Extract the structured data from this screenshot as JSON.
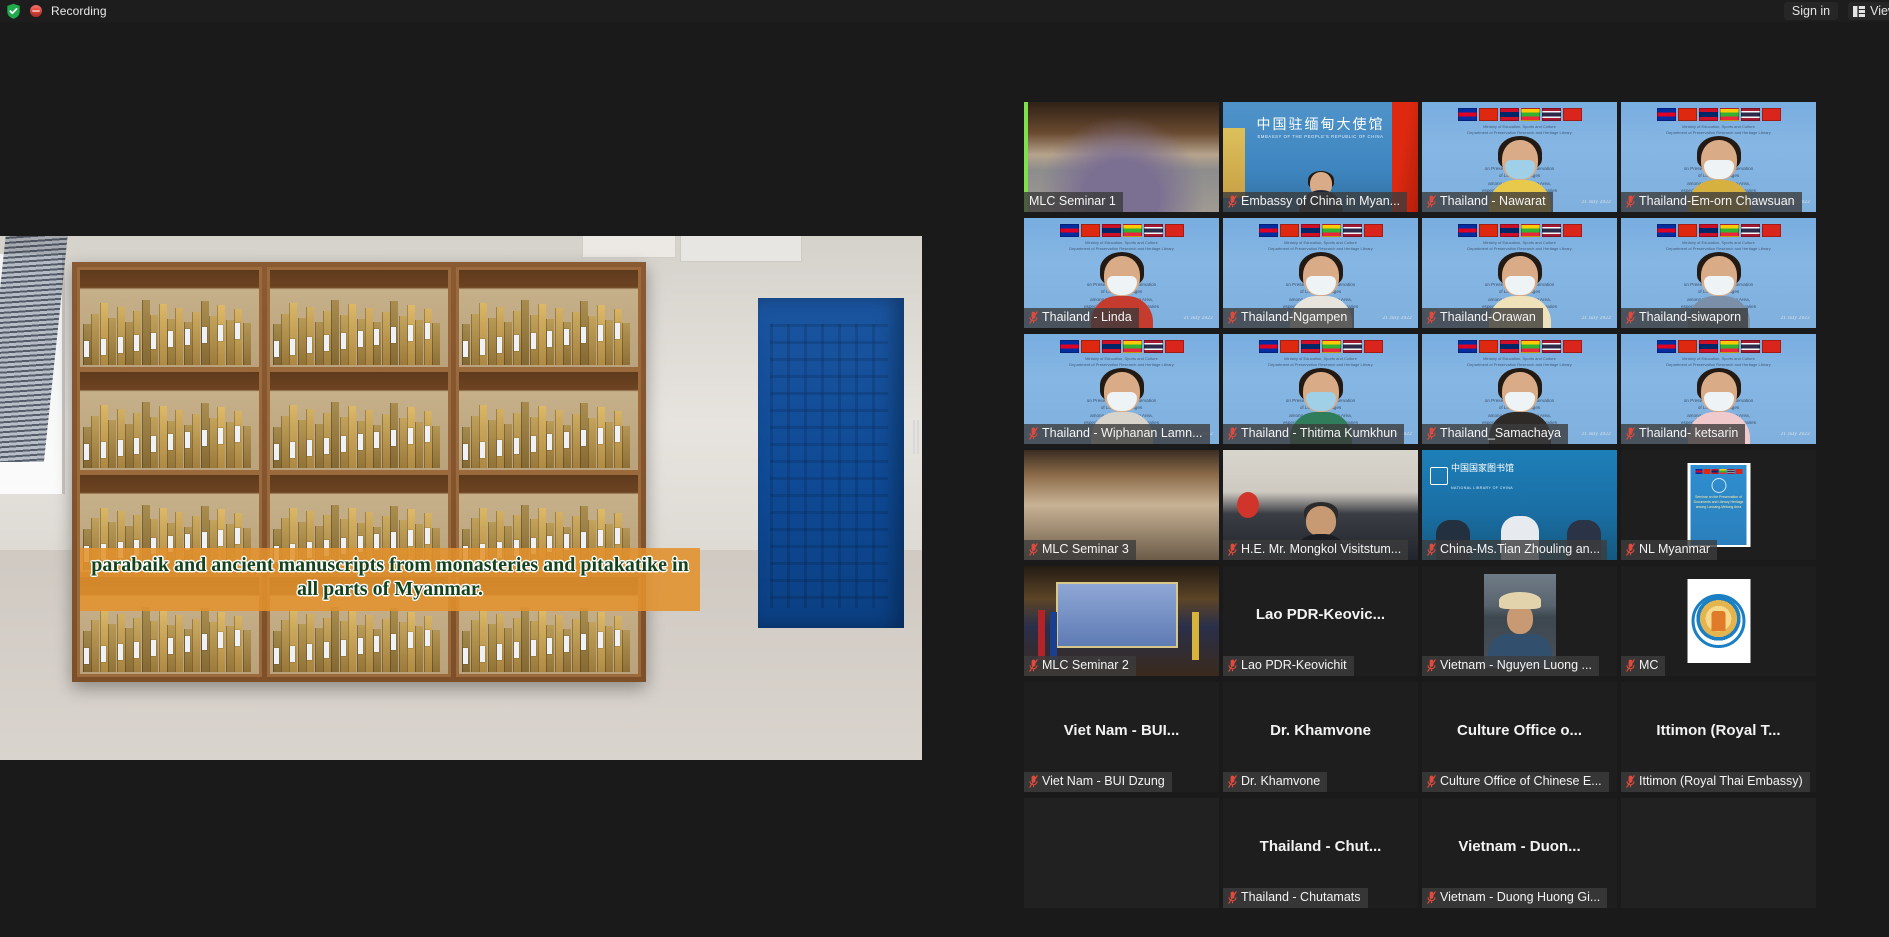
{
  "topbar": {
    "shield_icon": "shield-check-icon",
    "recording_icon": "recording-dot-icon",
    "recording_label": "Recording",
    "sign_in_label": "Sign in",
    "view_label": "View",
    "view_icon": "view-layout-icon"
  },
  "stage": {
    "caption": "parabaik and ancient manuscripts from monasteries and pitakatike in all parts of Myanmar.",
    "scrollbar_icon": "vertical-scrollbar"
  },
  "gallery": {
    "mic_icon": "microphone-muted-icon",
    "timestamp": "21 July 2022",
    "tiles": [
      {
        "name": "MLC Seminar 1",
        "active": true,
        "muted": false,
        "kind": "seminar1",
        "placeholder": false
      },
      {
        "name": "Embassy of China in Myan...",
        "active": false,
        "muted": true,
        "kind": "embassy",
        "placeholder": false
      },
      {
        "name": "Thailand - Nawarat",
        "active": false,
        "muted": true,
        "kind": "panel",
        "placeholder": false
      },
      {
        "name": "Thailand-Em-orn Chawsuan",
        "active": false,
        "muted": true,
        "kind": "panel",
        "placeholder": false
      },
      {
        "name": "Thailand - Linda",
        "active": false,
        "muted": true,
        "kind": "panel",
        "placeholder": false
      },
      {
        "name": "Thailand-Ngampen",
        "active": false,
        "muted": true,
        "kind": "panel",
        "placeholder": false
      },
      {
        "name": "Thailand-Orawan",
        "active": false,
        "muted": true,
        "kind": "panel",
        "placeholder": false
      },
      {
        "name": "Thailand-siwaporn",
        "active": false,
        "muted": true,
        "kind": "panel",
        "placeholder": false
      },
      {
        "name": "Thailand - Wiphanan Lamn...",
        "active": false,
        "muted": true,
        "kind": "panel",
        "placeholder": false
      },
      {
        "name": "Thailand - Thitima Kumkhun",
        "active": false,
        "muted": true,
        "kind": "panel",
        "placeholder": false
      },
      {
        "name": "Thailand_Samachaya",
        "active": false,
        "muted": true,
        "kind": "panel",
        "placeholder": false
      },
      {
        "name": "Thailand- ketsarin",
        "active": false,
        "muted": true,
        "kind": "panel",
        "placeholder": false
      },
      {
        "name": "MLC Seminar 3",
        "active": false,
        "muted": true,
        "kind": "seminar3",
        "placeholder": false
      },
      {
        "name": "H.E. Mr. Mongkol Visitstum...",
        "active": false,
        "muted": true,
        "kind": "mongkol",
        "placeholder": false
      },
      {
        "name": "China-Ms.Tian Zhouling an...",
        "active": false,
        "muted": true,
        "kind": "nlc",
        "placeholder": false
      },
      {
        "name": "NL Myanmar",
        "active": false,
        "muted": true,
        "kind": "nlmyanmar",
        "placeholder": false
      },
      {
        "name": "MLC Seminar 2",
        "active": false,
        "muted": true,
        "kind": "seminar2",
        "placeholder": false
      },
      {
        "name": "Lao PDR-Keovichit",
        "active": false,
        "muted": true,
        "kind": "dark",
        "placeholder": true,
        "big_name": "Lao  PDR-Keovic..."
      },
      {
        "name": "Vietnam - Nguyen Luong ...",
        "active": false,
        "muted": true,
        "kind": "vnphoto",
        "placeholder": false
      },
      {
        "name": "MC",
        "active": false,
        "muted": true,
        "kind": "mc",
        "placeholder": false
      },
      {
        "name": "Viet Nam - BUI Dzung",
        "active": false,
        "muted": true,
        "kind": "dark",
        "placeholder": true,
        "big_name": "Viet Nam - BUI..."
      },
      {
        "name": "Dr. Khamvone",
        "active": false,
        "muted": true,
        "kind": "dark",
        "placeholder": true,
        "big_name": "Dr. Khamvone"
      },
      {
        "name": "Culture Office of Chinese E...",
        "active": false,
        "muted": true,
        "kind": "dark",
        "placeholder": true,
        "big_name": "Culture Office o..."
      },
      {
        "name": "Ittimon (Royal Thai Embassy)",
        "active": false,
        "muted": true,
        "kind": "dark",
        "placeholder": true,
        "big_name": "Ittimon (Royal T..."
      },
      {
        "name": "",
        "active": false,
        "muted": false,
        "kind": "empty",
        "placeholder": false
      },
      {
        "name": "Thailand - Chutamats",
        "active": false,
        "muted": true,
        "kind": "dark",
        "placeholder": true,
        "big_name": "Thailand - Chut..."
      },
      {
        "name": "Vietnam - Duong Huong Gi...",
        "active": false,
        "muted": true,
        "kind": "dark",
        "placeholder": true,
        "big_name": "Vietnam - Duon..."
      },
      {
        "name": "",
        "active": false,
        "muted": false,
        "kind": "empty",
        "placeholder": false
      }
    ]
  },
  "colors": {
    "app_bg": "#1a1a1a",
    "topbar_bg": "#1d1d1d",
    "active_border": "#f2ef63",
    "speaking_bar": "#7ee04a",
    "mic_red": "#e04a3c",
    "caption_band": "#e2922d",
    "caption_text": "#14421c"
  }
}
